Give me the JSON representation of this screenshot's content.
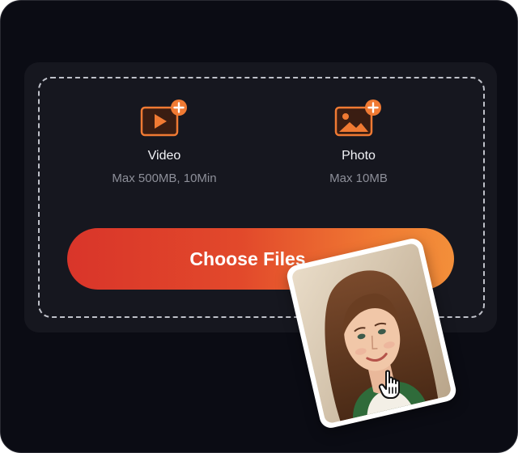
{
  "upload": {
    "video": {
      "label": "Video",
      "limit": "Max 500MB, 10Min",
      "icon": "video-add-icon"
    },
    "photo": {
      "label": "Photo",
      "limit": "Max 10MB",
      "icon": "image-add-icon"
    }
  },
  "choose_button": {
    "label": "Choose Files",
    "icon": "arrow-right-icon"
  },
  "colors": {
    "background": "#0b0c14",
    "panel": "#16171f",
    "accent": "#f07a33",
    "button_start": "#d9352a",
    "button_end": "#f38f3a"
  },
  "cursor": {
    "icon": "hand-pointer-icon"
  }
}
